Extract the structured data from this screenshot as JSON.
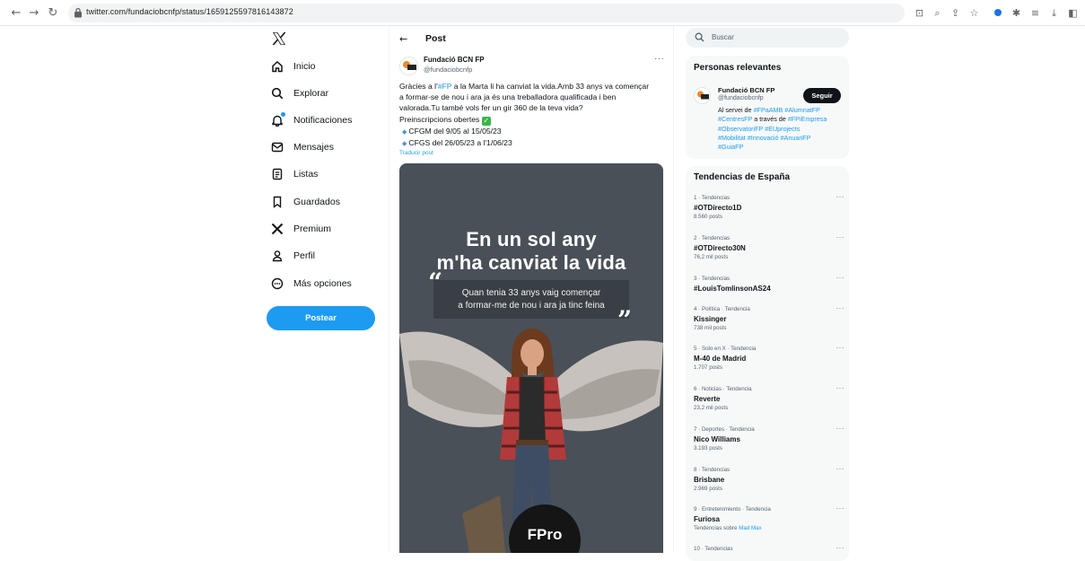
{
  "browser": {
    "url": "twitter.com/fundaciobcnfp/status/1659125597816143872",
    "back_glyph": "←",
    "forward_glyph": "→",
    "reload_glyph": "↻"
  },
  "sidebar": {
    "items": [
      {
        "label": "Inicio",
        "icon": "home-icon"
      },
      {
        "label": "Explorar",
        "icon": "search-icon"
      },
      {
        "label": "Notificaciones",
        "icon": "bell-icon"
      },
      {
        "label": "Mensajes",
        "icon": "mail-icon"
      },
      {
        "label": "Listas",
        "icon": "list-icon"
      },
      {
        "label": "Guardados",
        "icon": "bookmark-icon"
      },
      {
        "label": "Premium",
        "icon": "x-logo-icon"
      },
      {
        "label": "Perfil",
        "icon": "person-icon"
      },
      {
        "label": "Más opciones",
        "icon": "more-circle-icon"
      }
    ],
    "post_button": "Postear"
  },
  "header": {
    "back_glyph": "←",
    "title": "Post"
  },
  "tweet": {
    "author_name": "Fundació BCN FP",
    "author_handle": "@fundaciobcnfp",
    "more": "···",
    "text_l1_a": "Gràcies a l'",
    "text_l1_tag": "#FP",
    "text_l1_b": " a la Marta li ha canviat la vida.Amb 33 anys va començar",
    "text_l2": "a formar-se de nou i ara ja és una treballadora qualificada i ben",
    "text_l3": "valorada.Tu també vols fer un gir 360 de la teva vida?",
    "text_l4": " Preinscripcions obertes",
    "text_l5": "CFGM del 9/05 al 15/05/23",
    "text_l6": "CFGS del 26/05/23 a l'1/06/23",
    "translate": "Traducir post",
    "media": {
      "headline_1": "En un sol any",
      "headline_2": "m'ha canviat la vida",
      "quote_1": "Quan tenia 33 anys vaig començar",
      "quote_2": "a formar-me de nou i ara ja tinc feina",
      "open_quote": "“",
      "close_quote": "”",
      "badge": "FPro"
    }
  },
  "search": {
    "placeholder": "Buscar"
  },
  "relevant": {
    "title": "Personas relevantes",
    "name": "Fundació BCN FP",
    "handle": "@fundaciobcnfp",
    "follow": "Seguir",
    "bio_l1_a": "Al servei de ",
    "bio_l1_tag1": "#FPaAMB",
    "bio_l1_tag2": "#AlumnatFP",
    "bio_l2_tag": "#CentresFP",
    "bio_l2_b": " a través de ",
    "bio_l2_tag2": "#FPiEmpresa",
    "bio_l3_tag1": "#ObservatoriFP",
    "bio_l3_tag2": "#EUprojects",
    "bio_l4_tag1": "#Mobilitat",
    "bio_l4_tag2": "#Innovació",
    "bio_l4_tag3": "#AnuariFP",
    "bio_l5_tag": "#GuiaFP"
  },
  "trends": {
    "title": "Tendencias de España",
    "more": "···",
    "items": [
      {
        "context": "1 · Tendencias",
        "name": "#OTDirecto1D",
        "count": "8.560 posts"
      },
      {
        "context": "2 · Tendencias",
        "name": "#OTDirecto30N",
        "count": "76,2 mil posts"
      },
      {
        "context": "3 · Tendencias",
        "name": "#LouisTomlinsonAS24",
        "count": ""
      },
      {
        "context": "4 · Política · Tendencia",
        "name": "Kissinger",
        "count": "738 mil posts"
      },
      {
        "context": "5 · Solo en X · Tendencia",
        "name": "M-40 de Madrid",
        "count": "1.707 posts"
      },
      {
        "context": "6 · Noticias · Tendencia",
        "name": "Reverte",
        "count": "23,2 mil posts"
      },
      {
        "context": "7 · Deportes · Tendencia",
        "name": "Nico Williams",
        "count": "3.193 posts"
      },
      {
        "context": "8 · Tendencias",
        "name": "Brisbane",
        "count": "2.969 posts"
      },
      {
        "context": "9 · Entretenimiento · Tendencia",
        "name": "Furiosa",
        "count": "Tendencias sobre "
      },
      {
        "context": "10 · Tendencias",
        "name": "",
        "count": ""
      }
    ],
    "furiosa_tag": "Mad Max"
  },
  "colors": {
    "accent": "#1d9bf0",
    "text": "#0f1419",
    "muted": "#536471",
    "panel": "#f7f9f9",
    "media_bg": "#4a5058"
  }
}
